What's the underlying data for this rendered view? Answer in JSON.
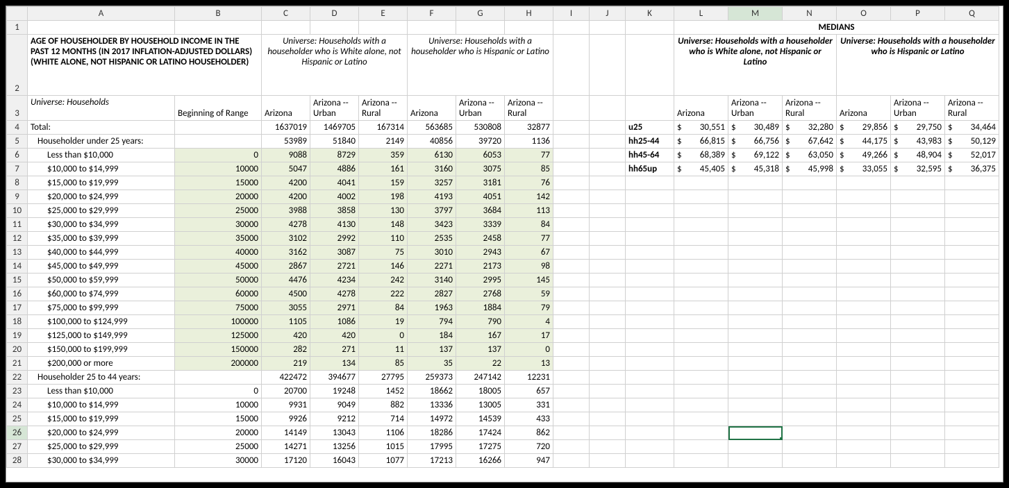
{
  "columns": [
    "A",
    "B",
    "C",
    "D",
    "E",
    "F",
    "G",
    "H",
    "I",
    "J",
    "K",
    "L",
    "M",
    "N",
    "O",
    "P",
    "Q"
  ],
  "row1": {
    "medians": "MEDIANS"
  },
  "row2": {
    "title": "AGE OF HOUSEHOLDER BY HOUSEHOLD INCOME IN THE PAST 12 MONTHS (IN 2017 INFLATION-ADJUSTED DOLLARS) (WHITE ALONE, NOT HISPANIC OR LATINO HOUSEHOLDER)",
    "univ_white": "Universe:  Households with a householder who is White alone, not Hispanic or Latino",
    "univ_hisp": "Universe:  Households with a householder who is Hispanic or Latino"
  },
  "row3": {
    "univ_hh": "Universe:  Households",
    "beg_range": "Beginning of Range",
    "az": "Arizona",
    "az_urban": "Arizona -- Urban",
    "az_rural": "Arizona -- Rural"
  },
  "medians": {
    "labels": {
      "u25": "u25",
      "hh25": "hh25-44",
      "hh45": "hh45-64",
      "hh65": "hh65up"
    },
    "u25": [
      "30,551",
      "30,489",
      "32,280",
      "29,856",
      "29,750",
      "34,464"
    ],
    "hh25": [
      "66,815",
      "66,756",
      "67,642",
      "44,175",
      "43,983",
      "50,129"
    ],
    "hh45": [
      "68,389",
      "69,122",
      "63,050",
      "49,266",
      "48,904",
      "52,017"
    ],
    "hh65": [
      "45,405",
      "45,318",
      "45,998",
      "33,055",
      "32,595",
      "36,375"
    ]
  },
  "rows": [
    {
      "n": 4,
      "A": "Total:",
      "B": "",
      "C": "1637019",
      "D": "1469705",
      "E": "167314",
      "F": "563685",
      "G": "530808",
      "H": "32877",
      "indent": 0,
      "hl": false
    },
    {
      "n": 5,
      "A": "Householder under 25 years:",
      "B": "",
      "C": "53989",
      "D": "51840",
      "E": "2149",
      "F": "40856",
      "G": "39720",
      "H": "1136",
      "indent": 1,
      "hl": false
    },
    {
      "n": 6,
      "A": "Less than $10,000",
      "B": "0",
      "C": "9088",
      "D": "8729",
      "E": "359",
      "F": "6130",
      "G": "6053",
      "H": "77",
      "indent": 2,
      "hl": true
    },
    {
      "n": 7,
      "A": "$10,000 to $14,999",
      "B": "10000",
      "C": "5047",
      "D": "4886",
      "E": "161",
      "F": "3160",
      "G": "3075",
      "H": "85",
      "indent": 2,
      "hl": true
    },
    {
      "n": 8,
      "A": "$15,000 to $19,999",
      "B": "15000",
      "C": "4200",
      "D": "4041",
      "E": "159",
      "F": "3257",
      "G": "3181",
      "H": "76",
      "indent": 2,
      "hl": true
    },
    {
      "n": 9,
      "A": "$20,000 to $24,999",
      "B": "20000",
      "C": "4200",
      "D": "4002",
      "E": "198",
      "F": "4193",
      "G": "4051",
      "H": "142",
      "indent": 2,
      "hl": true
    },
    {
      "n": 10,
      "A": "$25,000 to $29,999",
      "B": "25000",
      "C": "3988",
      "D": "3858",
      "E": "130",
      "F": "3797",
      "G": "3684",
      "H": "113",
      "indent": 2,
      "hl": true
    },
    {
      "n": 11,
      "A": "$30,000 to $34,999",
      "B": "30000",
      "C": "4278",
      "D": "4130",
      "E": "148",
      "F": "3423",
      "G": "3339",
      "H": "84",
      "indent": 2,
      "hl": true
    },
    {
      "n": 12,
      "A": "$35,000 to $39,999",
      "B": "35000",
      "C": "3102",
      "D": "2992",
      "E": "110",
      "F": "2535",
      "G": "2458",
      "H": "77",
      "indent": 2,
      "hl": true
    },
    {
      "n": 13,
      "A": "$40,000 to $44,999",
      "B": "40000",
      "C": "3162",
      "D": "3087",
      "E": "75",
      "F": "3010",
      "G": "2943",
      "H": "67",
      "indent": 2,
      "hl": true
    },
    {
      "n": 14,
      "A": "$45,000 to $49,999",
      "B": "45000",
      "C": "2867",
      "D": "2721",
      "E": "146",
      "F": "2271",
      "G": "2173",
      "H": "98",
      "indent": 2,
      "hl": true
    },
    {
      "n": 15,
      "A": "$50,000 to $59,999",
      "B": "50000",
      "C": "4476",
      "D": "4234",
      "E": "242",
      "F": "3140",
      "G": "2995",
      "H": "145",
      "indent": 2,
      "hl": true
    },
    {
      "n": 16,
      "A": "$60,000 to $74,999",
      "B": "60000",
      "C": "4500",
      "D": "4278",
      "E": "222",
      "F": "2827",
      "G": "2768",
      "H": "59",
      "indent": 2,
      "hl": true
    },
    {
      "n": 17,
      "A": "$75,000 to $99,999",
      "B": "75000",
      "C": "3055",
      "D": "2971",
      "E": "84",
      "F": "1963",
      "G": "1884",
      "H": "79",
      "indent": 2,
      "hl": true
    },
    {
      "n": 18,
      "A": "$100,000 to $124,999",
      "B": "100000",
      "C": "1105",
      "D": "1086",
      "E": "19",
      "F": "794",
      "G": "790",
      "H": "4",
      "indent": 2,
      "hl": true
    },
    {
      "n": 19,
      "A": "$125,000 to $149,999",
      "B": "125000",
      "C": "420",
      "D": "420",
      "E": "0",
      "F": "184",
      "G": "167",
      "H": "17",
      "indent": 2,
      "hl": true
    },
    {
      "n": 20,
      "A": "$150,000 to $199,999",
      "B": "150000",
      "C": "282",
      "D": "271",
      "E": "11",
      "F": "137",
      "G": "137",
      "H": "0",
      "indent": 2,
      "hl": true
    },
    {
      "n": 21,
      "A": "$200,000 or more",
      "B": "200000",
      "C": "219",
      "D": "134",
      "E": "85",
      "F": "35",
      "G": "22",
      "H": "13",
      "indent": 2,
      "hl": true
    },
    {
      "n": 22,
      "A": "Householder 25 to 44 years:",
      "B": "",
      "C": "422472",
      "D": "394677",
      "E": "27795",
      "F": "259373",
      "G": "247142",
      "H": "12231",
      "indent": 1,
      "hl": false
    },
    {
      "n": 23,
      "A": "Less than $10,000",
      "B": "0",
      "C": "20700",
      "D": "19248",
      "E": "1452",
      "F": "18662",
      "G": "18005",
      "H": "657",
      "indent": 2,
      "hl": false
    },
    {
      "n": 24,
      "A": "$10,000 to $14,999",
      "B": "10000",
      "C": "9931",
      "D": "9049",
      "E": "882",
      "F": "13336",
      "G": "13005",
      "H": "331",
      "indent": 2,
      "hl": false
    },
    {
      "n": 25,
      "A": "$15,000 to $19,999",
      "B": "15000",
      "C": "9926",
      "D": "9212",
      "E": "714",
      "F": "14972",
      "G": "14539",
      "H": "433",
      "indent": 2,
      "hl": false
    },
    {
      "n": 26,
      "A": "$20,000 to $24,999",
      "B": "20000",
      "C": "14149",
      "D": "13043",
      "E": "1106",
      "F": "18286",
      "G": "17424",
      "H": "862",
      "indent": 2,
      "hl": false
    },
    {
      "n": 27,
      "A": "$25,000 to $29,999",
      "B": "25000",
      "C": "14271",
      "D": "13256",
      "E": "1015",
      "F": "17995",
      "G": "17275",
      "H": "720",
      "indent": 2,
      "hl": false
    },
    {
      "n": 28,
      "A": "$30,000 to $34,999",
      "B": "30000",
      "C": "17120",
      "D": "16043",
      "E": "1077",
      "F": "17213",
      "G": "16266",
      "H": "947",
      "indent": 2,
      "hl": false
    }
  ],
  "selected": {
    "col": "M",
    "row": 26
  },
  "cur_sym": "$"
}
